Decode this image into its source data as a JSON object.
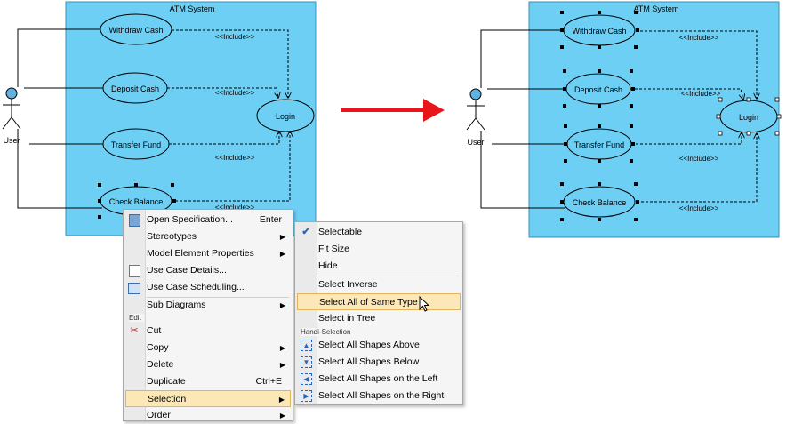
{
  "before": {
    "system_title": "ATM System",
    "actor_label": "User",
    "use_cases": [
      "Withdraw Cash",
      "Deposit Cash",
      "Transfer Fund",
      "Check Balance"
    ],
    "login_label": "Login",
    "include_label": "<<Include>>"
  },
  "after": {
    "system_title": "ATM System",
    "actor_label": "User",
    "use_cases": [
      "Withdraw Cash",
      "Deposit Cash",
      "Transfer Fund",
      "Check Balance"
    ],
    "login_label": "Login",
    "include_label": "<<Include>>"
  },
  "context_menu": {
    "items": [
      {
        "label": "Open Specification...",
        "shortcut": "Enter",
        "icon": "specification-icon"
      },
      {
        "label": "Stereotypes",
        "submenu": true
      },
      {
        "label": "Model Element Properties",
        "submenu": true
      },
      {
        "label": "Use Case Details...",
        "icon": "use-case-details-icon"
      },
      {
        "label": "Use Case Scheduling...",
        "icon": "scheduling-icon"
      },
      {
        "label": "Sub Diagrams",
        "submenu": true
      },
      {
        "label": "Cut",
        "icon": "scissors-icon"
      },
      {
        "label": "Copy",
        "submenu": true
      },
      {
        "label": "Delete",
        "submenu": true
      },
      {
        "label": "Duplicate",
        "shortcut": "Ctrl+E"
      },
      {
        "label": "Selection",
        "submenu": true,
        "highlighted": true
      },
      {
        "label": "Order",
        "submenu": true
      }
    ],
    "edit_group": "Edit"
  },
  "selection_submenu": {
    "items": [
      {
        "label": "Selectable",
        "checked": true
      },
      {
        "label": "Fit Size"
      },
      {
        "label": "Hide"
      },
      {
        "label": "Select Inverse"
      },
      {
        "label": "Select All of Same Type",
        "highlighted": true
      },
      {
        "label": "Select in Tree"
      },
      {
        "label": "Select All Shapes Above",
        "icon": "select-above-icon"
      },
      {
        "label": "Select All Shapes Below",
        "icon": "select-below-icon"
      },
      {
        "label": "Select All Shapes on the Left",
        "icon": "select-left-icon"
      },
      {
        "label": "Select All Shapes on the Right",
        "icon": "select-right-icon"
      }
    ],
    "handi_group": "Handi-Selection"
  },
  "colors": {
    "system_fill": "#6ecff5",
    "arrow": "#e8151b",
    "menu_highlight": "#fbe8b6",
    "actor_head": "#5fb3e0"
  }
}
